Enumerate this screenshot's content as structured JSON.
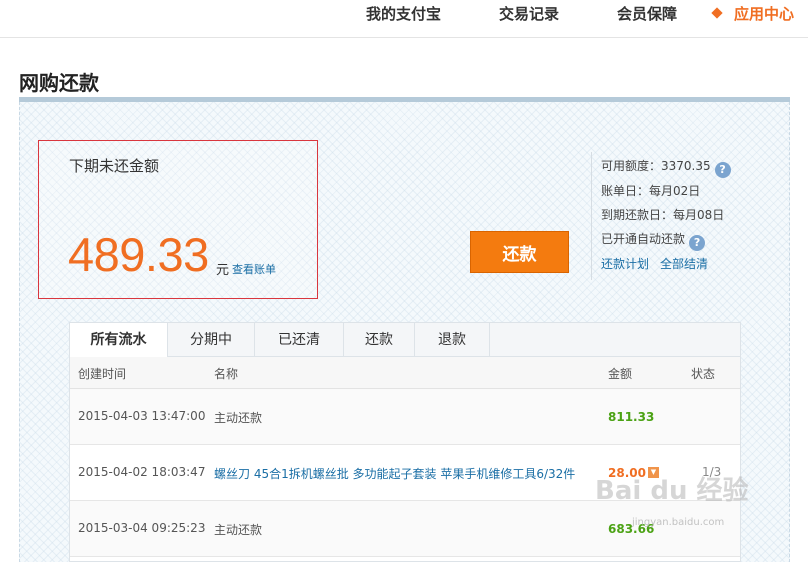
{
  "nav": {
    "items": [
      {
        "label": "我的支付宝"
      },
      {
        "label": "交易记录"
      },
      {
        "label": "会员保障"
      },
      {
        "label": "应用中心"
      }
    ]
  },
  "page": {
    "title": "网购还款"
  },
  "due": {
    "label": "下期未还金额",
    "amount": "489.33",
    "unit": "元",
    "bill_link": "查看账单"
  },
  "repay_button": "还款",
  "info": {
    "credit": "可用额度：3370.35",
    "bill_day": "账单日：每月02日",
    "due_day": "到期还款日：每月08日",
    "auto_repay": "已开通自动还款",
    "plan_link": "还款计划",
    "settle_link": "全部结清",
    "help_glyph": "?"
  },
  "tabs": [
    "所有流水",
    "分期中",
    "已还清",
    "还款",
    "退款"
  ],
  "table": {
    "headers": [
      "创建时间",
      "名称",
      "金额",
      "状态"
    ],
    "rows": [
      {
        "time": "2015-04-03 13:47:00",
        "name": "主动还款",
        "amount": "811.33",
        "status": ""
      },
      {
        "time": "2015-04-02 18:03:47",
        "name": "螺丝刀  45合1拆机螺丝批  多功能起子套装  苹果手机维修工具6/32件",
        "amount": "28.00",
        "status": "1/3"
      },
      {
        "time": "2015-03-04 09:25:23",
        "name": "主动还款",
        "amount": "683.66",
        "status": ""
      }
    ]
  },
  "watermark": {
    "main": "Bai du 经验",
    "sub": "jingyan.baidu.com"
  },
  "colors": {
    "accent": "#f06e22",
    "link": "#1a6ea5",
    "green": "#4ba214",
    "highlight_box": "#d9363e"
  }
}
